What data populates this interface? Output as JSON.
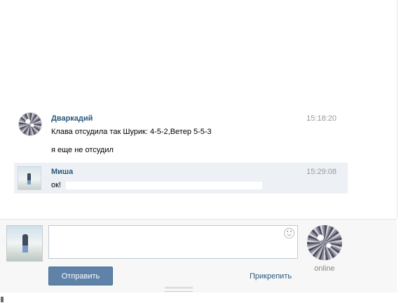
{
  "messages": [
    {
      "author": "Дваркадий",
      "time": "15:18:20",
      "lines": [
        "Клава отсудила так Шурик: 4-5-2,Ветер 5-5-3",
        "я еще не отсудил"
      ],
      "avatar": "crystal-avatar"
    },
    {
      "author": "Миша",
      "time": "15:29:08",
      "lines": [
        "ок!"
      ],
      "avatar": "child-photo-avatar",
      "highlighted": true
    }
  ],
  "compose": {
    "placeholder": "",
    "value": "",
    "send_label": "Отправить",
    "attach_label": "Прикрепить",
    "partner_status": "online",
    "smile_icon": "smile-icon"
  },
  "colors": {
    "author": "#2b587a",
    "send_button": "#5e82a8",
    "highlight": "#edf1f5",
    "time": "#999999"
  }
}
